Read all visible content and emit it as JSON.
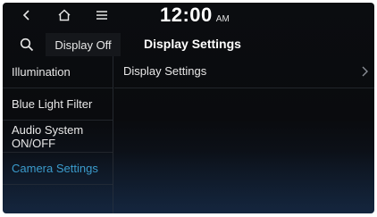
{
  "status_bar": {
    "time": "12:00",
    "ampm": "AM",
    "icons": [
      "back-icon",
      "home-icon",
      "menu-icon"
    ]
  },
  "header": {
    "search_icon": "search-icon",
    "display_off_label": "Display Off",
    "title": "Display Settings"
  },
  "sidebar": {
    "items": [
      {
        "label": "Illumination",
        "active": false
      },
      {
        "label": "Blue Light Filter",
        "active": false
      },
      {
        "label": "Audio System ON/OFF",
        "active": false
      },
      {
        "label": "Camera Settings",
        "active": true
      }
    ]
  },
  "main": {
    "rows": [
      {
        "label": "Display Settings",
        "icon": "chevron-right-icon"
      }
    ]
  },
  "colors": {
    "background": "#0b0d10",
    "active_text": "#3ea6d8",
    "text": "#e8e8e8"
  }
}
